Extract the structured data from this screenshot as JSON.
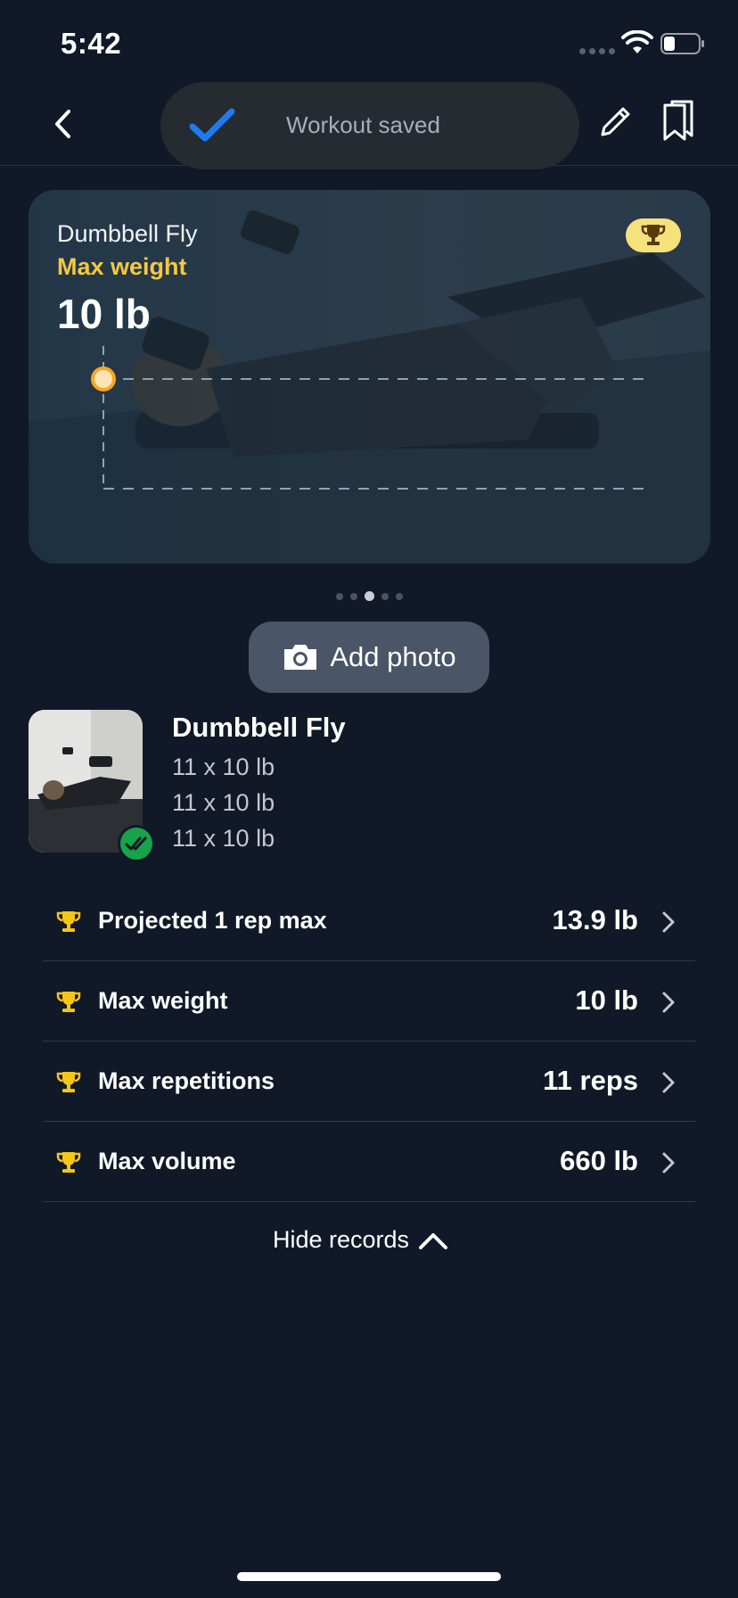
{
  "status_bar": {
    "time": "5:42"
  },
  "nav": {
    "toast_text": "Workout saved"
  },
  "hero": {
    "exercise": "Dumbbell Fly",
    "metric": "Max weight",
    "value": "10 lb"
  },
  "pagination": {
    "count": 5,
    "active_index": 2
  },
  "add_photo": {
    "label": "Add photo"
  },
  "exercise": {
    "name": "Dumbbell Fly",
    "sets": [
      "11 x 10 lb",
      "11 x 10 lb",
      "11 x 10 lb"
    ]
  },
  "records": [
    {
      "label": "Projected 1 rep max",
      "value": "13.9 lb"
    },
    {
      "label": "Max weight",
      "value": "10 lb"
    },
    {
      "label": "Max repetitions",
      "value": "11 reps"
    },
    {
      "label": "Max volume",
      "value": "660 lb"
    }
  ],
  "hide_records": {
    "label": "Hide records"
  },
  "colors": {
    "background": "#111827",
    "accent_blue": "#1d7cf2",
    "trophy_gold": "#f5c518",
    "metric_yellow": "#f5c842",
    "success_green": "#16a34a",
    "chart_point": "#f7a623"
  },
  "icons": {
    "back": "chevron-left-icon",
    "toast": "checkmark-icon",
    "edit": "pencil-icon",
    "bookmark": "bookmark-icon",
    "camera": "camera-icon",
    "trophy": "trophy-icon",
    "chevron": "chevron-right-icon",
    "collapse": "chevron-up-icon"
  }
}
